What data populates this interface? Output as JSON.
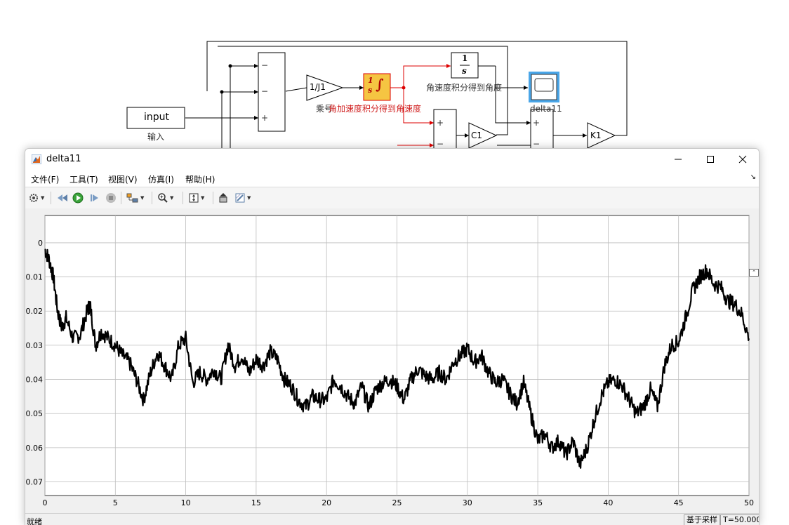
{
  "diagram": {
    "labels": {
      "input_block": "input",
      "input_caption": "输入",
      "gain1": "1/J1",
      "gain1_caption": "乘号",
      "integrator_caption": "角加速度积分得到角速度",
      "integrator2_caption": "角速度积分得到角度",
      "scope_caption": "delta11",
      "c1": "C1",
      "k1": "K1",
      "tf_num": "1",
      "tf_den": "s",
      "minus": "−",
      "plus": "+"
    }
  },
  "window": {
    "title": "delta11",
    "menu": [
      "文件(F)",
      "工具(T)",
      "视图(V)",
      "仿真(I)",
      "帮助(H)"
    ],
    "undock_icon": "undock-icon",
    "controls": [
      "minimize-icon",
      "maximize-icon",
      "close-icon"
    ],
    "toolbar_icons": [
      "gear-icon",
      "step-back-icon",
      "run-icon",
      "step-forward-icon",
      "stop-icon",
      "highlight-icon",
      "zoom-in-icon",
      "autoscale-icon",
      "cursor-icon",
      "style-icon"
    ]
  },
  "status": {
    "left": "就绪",
    "mode": "基于采样",
    "time": "T=50.000"
  },
  "chart_data": {
    "type": "line",
    "x_ticks": [
      0,
      5,
      10,
      15,
      20,
      25,
      30,
      35,
      40,
      45,
      50
    ],
    "y_ticks": [
      0,
      -0.01,
      -0.02,
      -0.03,
      -0.04,
      -0.05,
      -0.06,
      -0.07
    ],
    "y_tick_labels": [
      "0",
      "-0.01",
      "-0.02",
      "-0.03",
      "-0.04",
      "-0.05",
      "-0.06",
      "-0.07"
    ],
    "xlim": [
      0,
      50
    ],
    "ylim": [
      -0.074,
      0.008
    ],
    "grid": true,
    "line_color": "#000000",
    "x": [
      0,
      0.3,
      0.6,
      0.9,
      1.2,
      1.5,
      2.0,
      2.5,
      3.0,
      3.2,
      3.6,
      4.0,
      4.5,
      5.0,
      5.5,
      6.0,
      6.5,
      7.0,
      7.5,
      8.0,
      8.5,
      9.0,
      9.5,
      10.0,
      10.5,
      11.0,
      11.5,
      12.0,
      12.5,
      13.0,
      13.5,
      14.0,
      14.5,
      15.0,
      15.5,
      16.0,
      16.5,
      17.0,
      17.5,
      18.0,
      18.5,
      19.0,
      19.5,
      20.0,
      20.5,
      21.0,
      21.5,
      22.0,
      22.5,
      23.0,
      23.5,
      24.0,
      24.5,
      25.0,
      25.5,
      26.0,
      26.5,
      27.0,
      27.5,
      28.0,
      28.5,
      29.0,
      29.5,
      30.0,
      30.5,
      31.0,
      31.5,
      32.0,
      32.5,
      33.0,
      33.5,
      34.0,
      34.5,
      35.0,
      35.5,
      36.0,
      36.5,
      37.0,
      37.5,
      38.0,
      38.5,
      39.0,
      39.5,
      40.0,
      40.5,
      41.0,
      41.5,
      42.0,
      42.5,
      43.0,
      43.5,
      44.0,
      44.5,
      45.0,
      45.5,
      46.0,
      46.5,
      47.0,
      47.5,
      48.0,
      48.5,
      49.0,
      49.5,
      50.0
    ],
    "y": [
      -0.002,
      -0.005,
      -0.01,
      -0.02,
      -0.025,
      -0.022,
      -0.028,
      -0.027,
      -0.02,
      -0.018,
      -0.03,
      -0.026,
      -0.028,
      -0.03,
      -0.033,
      -0.035,
      -0.04,
      -0.046,
      -0.038,
      -0.032,
      -0.036,
      -0.04,
      -0.03,
      -0.028,
      -0.041,
      -0.038,
      -0.04,
      -0.037,
      -0.04,
      -0.03,
      -0.036,
      -0.033,
      -0.038,
      -0.034,
      -0.036,
      -0.032,
      -0.034,
      -0.04,
      -0.042,
      -0.046,
      -0.048,
      -0.045,
      -0.046,
      -0.046,
      -0.04,
      -0.042,
      -0.045,
      -0.047,
      -0.042,
      -0.048,
      -0.043,
      -0.041,
      -0.04,
      -0.042,
      -0.046,
      -0.04,
      -0.037,
      -0.039,
      -0.04,
      -0.038,
      -0.04,
      -0.035,
      -0.033,
      -0.031,
      -0.035,
      -0.033,
      -0.038,
      -0.041,
      -0.04,
      -0.044,
      -0.047,
      -0.041,
      -0.05,
      -0.058,
      -0.056,
      -0.06,
      -0.058,
      -0.062,
      -0.058,
      -0.065,
      -0.06,
      -0.052,
      -0.045,
      -0.041,
      -0.04,
      -0.042,
      -0.046,
      -0.05,
      -0.048,
      -0.043,
      -0.048,
      -0.036,
      -0.03,
      -0.029,
      -0.022,
      -0.014,
      -0.01,
      -0.008,
      -0.012,
      -0.013,
      -0.017,
      -0.018,
      -0.021,
      -0.028
    ]
  }
}
